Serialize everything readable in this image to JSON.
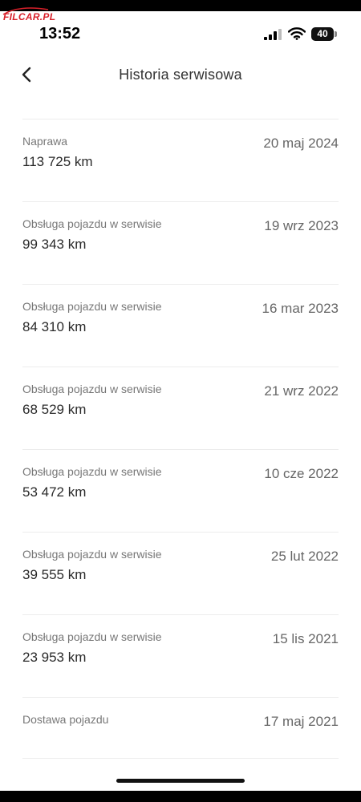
{
  "watermark": {
    "text": "FILCAR.PL"
  },
  "status_bar": {
    "time": "13:52",
    "battery": "40",
    "icons": [
      "signal-bars-icon",
      "wifi-icon",
      "battery-icon"
    ]
  },
  "header": {
    "back_icon": "chevron-left-icon",
    "title": "Historia serwisowa"
  },
  "history": [
    {
      "type": "Naprawa",
      "mileage": "113 725 km",
      "date": "20 maj 2024"
    },
    {
      "type": "Obsługa pojazdu w serwisie",
      "mileage": "99 343 km",
      "date": "19 wrz 2023"
    },
    {
      "type": "Obsługa pojazdu w serwisie",
      "mileage": "84 310 km",
      "date": "16 mar 2023"
    },
    {
      "type": "Obsługa pojazdu w serwisie",
      "mileage": "68 529 km",
      "date": "21 wrz 2022"
    },
    {
      "type": "Obsługa pojazdu w serwisie",
      "mileage": "53 472 km",
      "date": "10 cze 2022"
    },
    {
      "type": "Obsługa pojazdu w serwisie",
      "mileage": "39 555 km",
      "date": "25 lut 2022"
    },
    {
      "type": "Obsługa pojazdu w serwisie",
      "mileage": "23 953 km",
      "date": "15 lis 2021"
    },
    {
      "type": "Dostawa pojazdu",
      "mileage": "",
      "date": "17 maj 2021"
    }
  ],
  "colors": {
    "watermark": "#d8202a",
    "divider": "#ececec",
    "secondary_text": "#777777"
  }
}
